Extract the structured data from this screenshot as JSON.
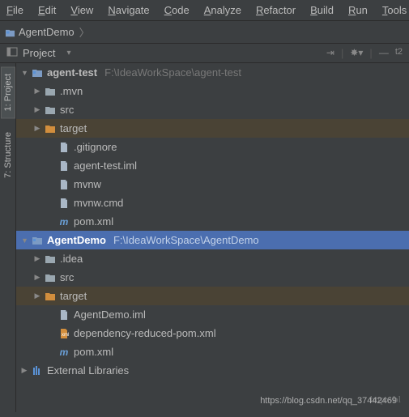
{
  "menu": [
    "File",
    "Edit",
    "View",
    "Navigate",
    "Code",
    "Analyze",
    "Refactor",
    "Build",
    "Run",
    "Tools"
  ],
  "breadcrumb": {
    "project": "AgentDemo"
  },
  "toolwindow": {
    "title": "Project",
    "right_text": "t2"
  },
  "sidebar": {
    "tabs": [
      "1: Project",
      "7: Structure"
    ]
  },
  "tree": [
    {
      "label": "agent-test",
      "path": "F:\\IdeaWorkSpace\\agent-test",
      "type": "module",
      "expanded": true,
      "indent": 0,
      "bold": true
    },
    {
      "label": ".mvn",
      "type": "folder",
      "expanded": false,
      "indent": 1
    },
    {
      "label": "src",
      "type": "folder",
      "expanded": false,
      "indent": 1
    },
    {
      "label": "target",
      "type": "folder-orange",
      "expanded": false,
      "indent": 1,
      "highlight": true
    },
    {
      "label": ".gitignore",
      "type": "file",
      "indent": 2
    },
    {
      "label": "agent-test.iml",
      "type": "file",
      "indent": 2
    },
    {
      "label": "mvnw",
      "type": "file",
      "indent": 2
    },
    {
      "label": "mvnw.cmd",
      "type": "file",
      "indent": 2
    },
    {
      "label": "pom.xml",
      "type": "maven",
      "indent": 2
    },
    {
      "label": "AgentDemo",
      "path": "F:\\IdeaWorkSpace\\AgentDemo",
      "type": "module",
      "expanded": true,
      "indent": 0,
      "selected": true,
      "bold": true
    },
    {
      "label": ".idea",
      "type": "folder",
      "expanded": false,
      "indent": 1
    },
    {
      "label": "src",
      "type": "folder",
      "expanded": false,
      "indent": 1
    },
    {
      "label": "target",
      "type": "folder-orange",
      "expanded": false,
      "indent": 1,
      "highlight": true
    },
    {
      "label": "AgentDemo.iml",
      "type": "file",
      "indent": 2
    },
    {
      "label": "dependency-reduced-pom.xml",
      "type": "xml",
      "indent": 2
    },
    {
      "label": "pom.xml",
      "type": "maven",
      "indent": 2
    },
    {
      "label": "External Libraries",
      "type": "libs",
      "expanded": false,
      "indent": 0
    }
  ],
  "watermark": {
    "bg": "http://bl",
    "fg": "https://blog.csdn.net/qq_37442469"
  }
}
